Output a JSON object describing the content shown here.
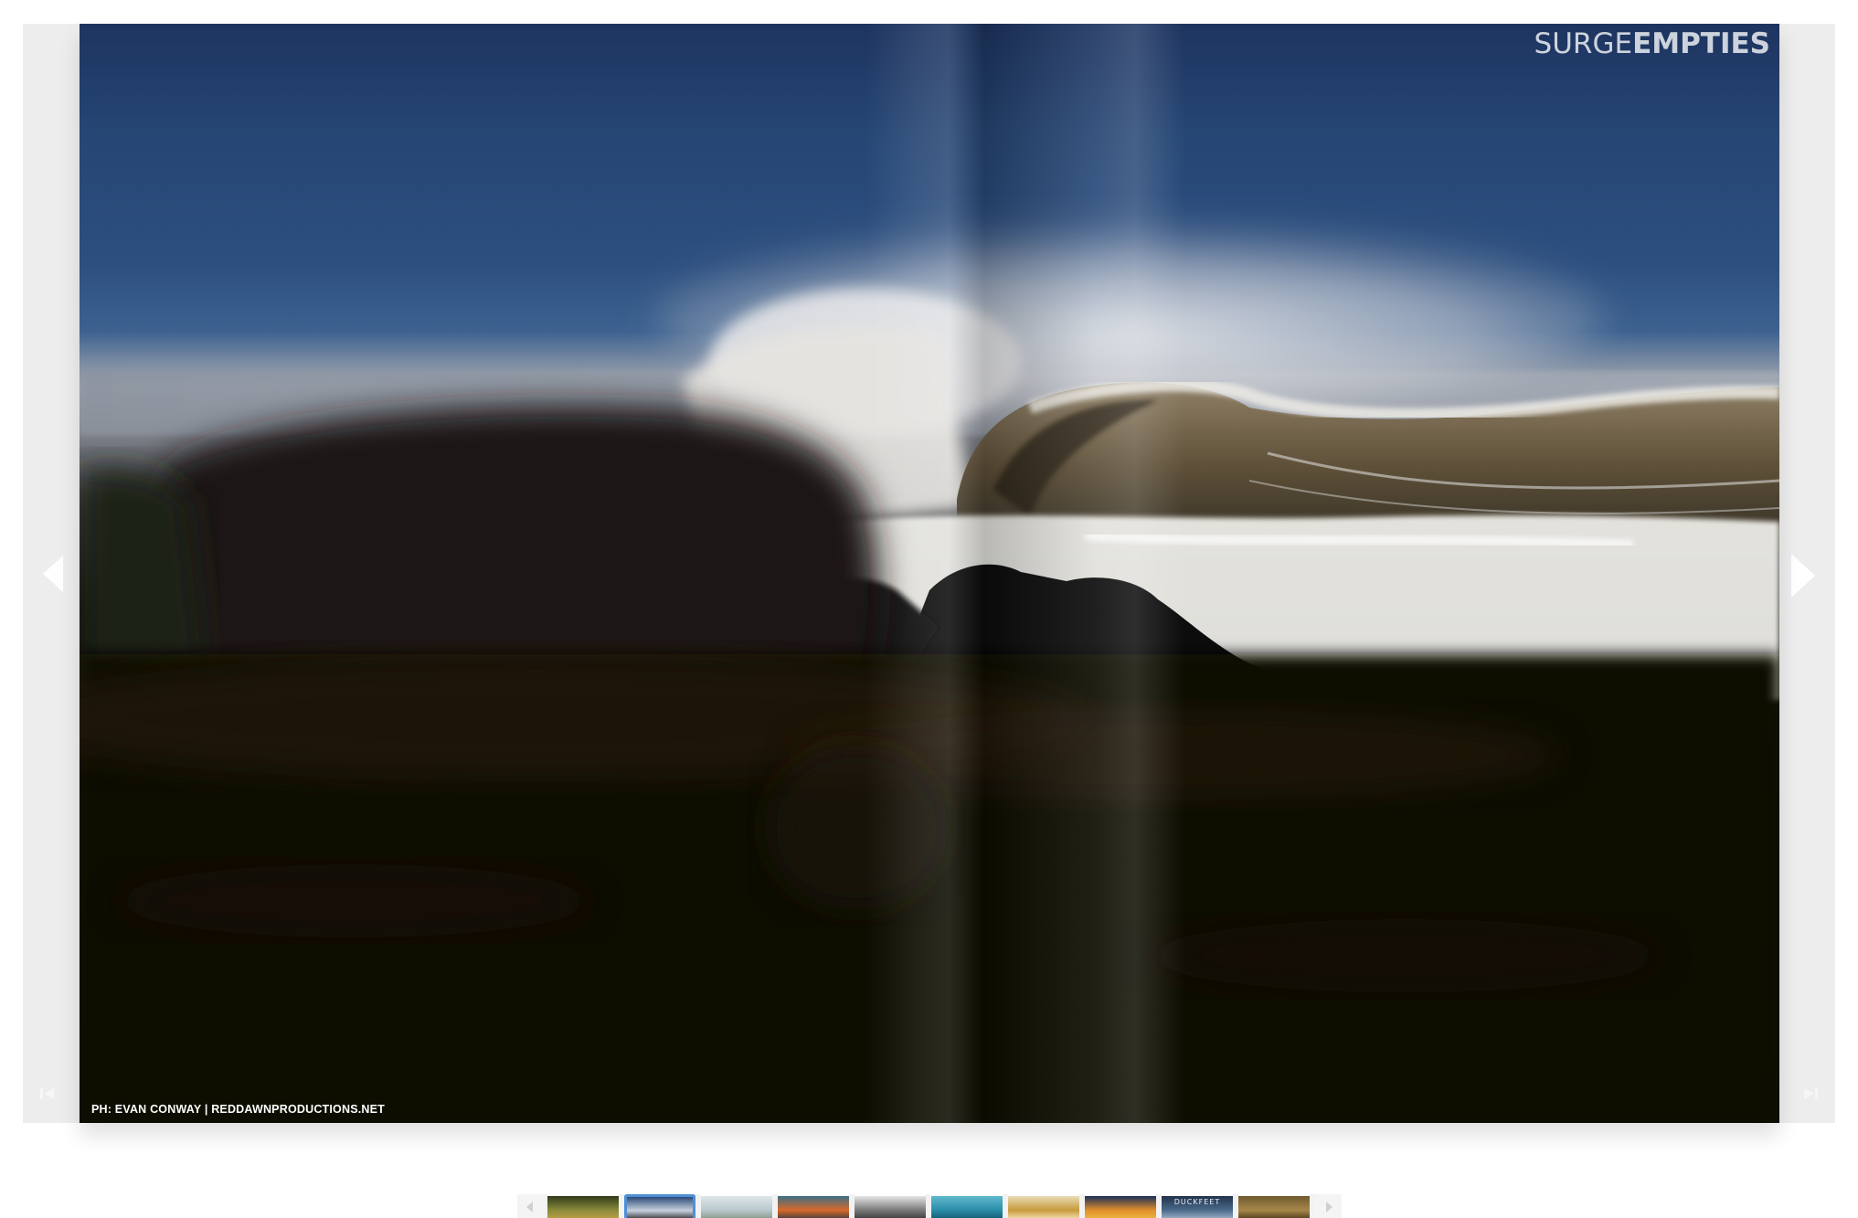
{
  "viewer": {
    "brand_light": "SURGE",
    "brand_bold": "EMPTIES",
    "photo_credit": "PH: EVAN CONWAY | REDDAWNPRODUCTIONS.NET"
  },
  "thumbnails": [
    {
      "name": "thumb-1",
      "label": "",
      "colors": [
        "#2f3a1a",
        "#8a8a3a",
        "#c9a64a"
      ],
      "selected": false
    },
    {
      "name": "thumb-2",
      "label": "",
      "colors": [
        "#2b4a78",
        "#c8d0dc",
        "#0d0d0d"
      ],
      "selected": true
    },
    {
      "name": "thumb-3",
      "label": "",
      "colors": [
        "#dfe6ea",
        "#b9c8cc",
        "#7a8e78"
      ],
      "selected": false
    },
    {
      "name": "thumb-4",
      "label": "",
      "colors": [
        "#3c6e86",
        "#d86a2a",
        "#1e3240"
      ],
      "selected": false
    },
    {
      "name": "thumb-5",
      "label": "",
      "colors": [
        "#e4e4e4",
        "#7a7a7a",
        "#2a2a2a"
      ],
      "selected": false
    },
    {
      "name": "thumb-6",
      "label": "",
      "colors": [
        "#5fb9cc",
        "#2a8ca8",
        "#0f4e66"
      ],
      "selected": false
    },
    {
      "name": "thumb-7",
      "label": "",
      "colors": [
        "#e9dcb6",
        "#c79a3c",
        "#fff2d2"
      ],
      "selected": false
    },
    {
      "name": "thumb-8",
      "label": "",
      "colors": [
        "#1c2e58",
        "#e0902a",
        "#f2c24a"
      ],
      "selected": false
    },
    {
      "name": "thumb-9",
      "label": "DUCKFEET",
      "colors": [
        "#22324c",
        "#4a6a8a",
        "#b8c6d6"
      ],
      "selected": false
    },
    {
      "name": "thumb-10",
      "label": "",
      "colors": [
        "#6e5a2e",
        "#a8874a",
        "#3a2a14"
      ],
      "selected": false
    }
  ],
  "colors": {
    "selected_thumb_border": "#4f8fd6",
    "frame_background": "#ededed"
  }
}
